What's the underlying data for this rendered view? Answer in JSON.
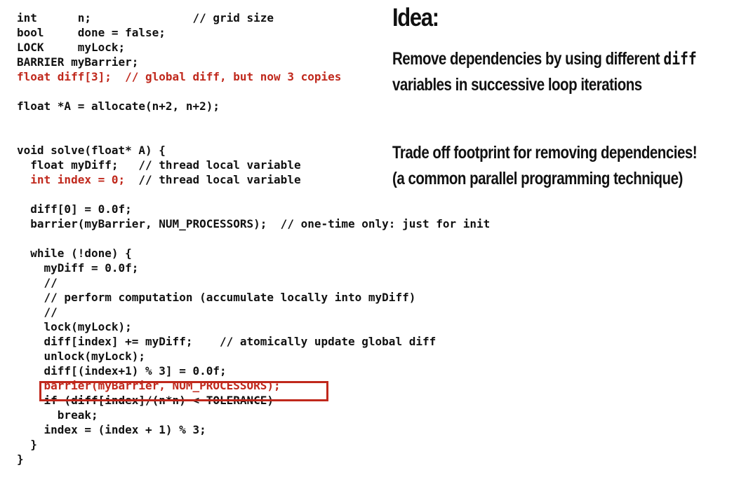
{
  "code_lines": [
    {
      "text": "int      n;               // grid size",
      "red": false
    },
    {
      "text": "bool     done = false;",
      "red": false
    },
    {
      "text": "LOCK     myLock;",
      "red": false
    },
    {
      "text": "BARRIER myBarrier;",
      "red": false
    },
    {
      "text": "float diff[3];  // global diff, but now 3 copies",
      "red": true
    },
    {
      "text": "",
      "red": false
    },
    {
      "text": "float *A = allocate(n+2, n+2);",
      "red": false
    },
    {
      "text": "",
      "red": false
    },
    {
      "text": "",
      "red": false
    },
    {
      "text": "void solve(float* A) {",
      "red": false
    },
    {
      "text": "  float myDiff;   // thread local variable",
      "red": false
    },
    {
      "text": "  int index = 0;  // thread local variable",
      "red": "partial"
    },
    {
      "text": "",
      "red": false
    },
    {
      "text": "  diff[0] = 0.0f;",
      "red": false
    },
    {
      "text": "  barrier(myBarrier, NUM_PROCESSORS);  // one-time only: just for init",
      "red": false
    },
    {
      "text": "",
      "red": false
    },
    {
      "text": "  while (!done) {",
      "red": false
    },
    {
      "text": "    myDiff = 0.0f;",
      "red": false
    },
    {
      "text": "    //",
      "red": false
    },
    {
      "text": "    // perform computation (accumulate locally into myDiff)",
      "red": false
    },
    {
      "text": "    //",
      "red": false
    },
    {
      "text": "    lock(myLock);",
      "red": false
    },
    {
      "text": "    diff[index] += myDiff;    // atomically update global diff",
      "red": false
    },
    {
      "text": "    unlock(myLock);",
      "red": false
    },
    {
      "text": "    diff[(index+1) % 3] = 0.0f;",
      "red": false
    },
    {
      "text": "    barrier(myBarrier, NUM_PROCESSORS);",
      "red": true
    },
    {
      "text": "    if (diff[index]/(n*n) < TOLERANCE)",
      "red": false
    },
    {
      "text": "      break;",
      "red": false
    },
    {
      "text": "    index = (index + 1) % 3;",
      "red": false
    },
    {
      "text": "  }",
      "red": false
    },
    {
      "text": "}",
      "red": false
    }
  ],
  "code_partial": {
    "line11_red": "  int index = 0;",
    "line11_rest": "  // thread local variable"
  },
  "heading": "Idea:",
  "para1": {
    "line1_pre": "Remove dependencies by using different ",
    "line1_code": "diff",
    "line2": "variables in successive loop iterations"
  },
  "para2": {
    "line1": "Trade off footprint for removing dependencies!",
    "line2": "(a common parallel programming technique)"
  },
  "colors": {
    "text": "#111111",
    "accent_red": "#c0281c",
    "background": "#ffffff"
  }
}
